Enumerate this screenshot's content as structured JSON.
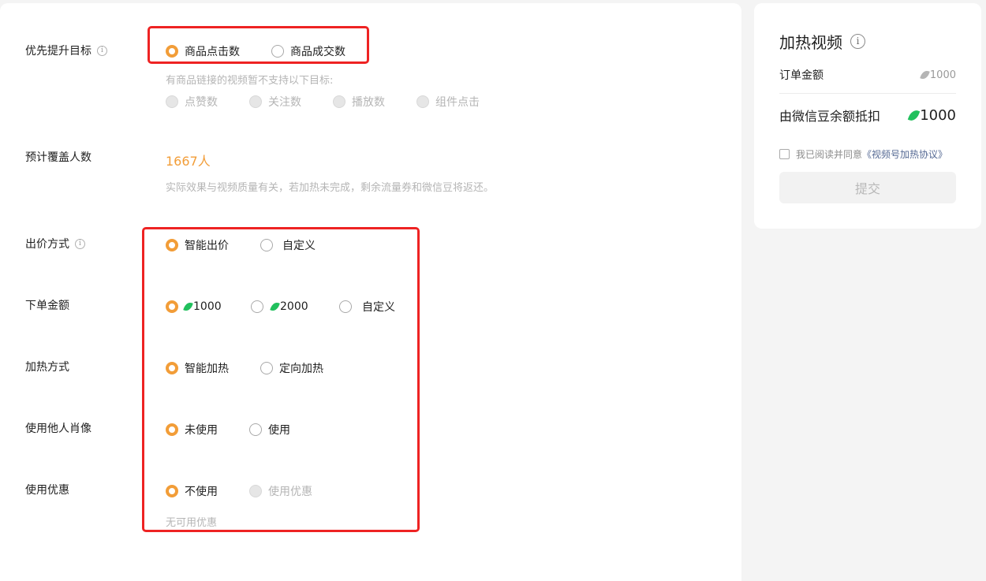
{
  "goal": {
    "label": "优先提升目标",
    "options": [
      "商品点击数",
      "商品成交数"
    ],
    "selected": 0,
    "unsupported_hint": "有商品链接的视频暂不支持以下目标:",
    "unsupported_options": [
      "点赞数",
      "关注数",
      "播放数",
      "组件点击"
    ]
  },
  "reach": {
    "label": "预计覆盖人数",
    "value": "1667人",
    "note": "实际效果与视频质量有关，若加热未完成，剩余流量券和微信豆将返还。"
  },
  "bid": {
    "label": "出价方式",
    "options": [
      "智能出价",
      "自定义"
    ],
    "selected": 0
  },
  "amount": {
    "label": "下单金额",
    "options": [
      "1000",
      "2000",
      "自定义"
    ],
    "selected": 0
  },
  "heat": {
    "label": "加热方式",
    "options": [
      "智能加热",
      "定向加热"
    ],
    "selected": 0
  },
  "portrait": {
    "label": "使用他人肖像",
    "options": [
      "未使用",
      "使用"
    ],
    "selected": 0
  },
  "coupon": {
    "label": "使用优惠",
    "options": [
      "不使用",
      "使用优惠"
    ],
    "selected": 0,
    "note": "无可用优惠"
  },
  "side": {
    "title": "加热视频",
    "order_label": "订单金额",
    "order_value": "1000",
    "deduct_label": "由微信豆余额抵扣",
    "deduct_value": "1000",
    "agree_text": "我已阅读并同意",
    "agree_link": "《视频号加热协议》",
    "submit_label": "提交"
  },
  "colors": {
    "accent": "#f29d38",
    "bean": "#21c05d",
    "highlight_box": "#ee2323",
    "link": "#576b95"
  }
}
